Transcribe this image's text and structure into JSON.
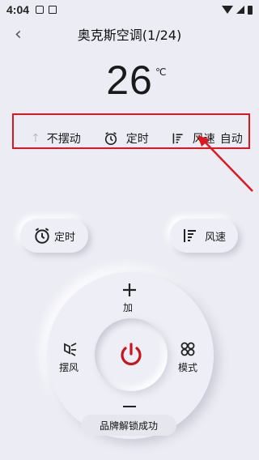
{
  "status_bar": {
    "time": "4:04"
  },
  "header": {
    "back_glyph": "‹",
    "title": "奥克斯空调(1/24)"
  },
  "temperature": {
    "value": "26",
    "unit": "℃"
  },
  "status_row": {
    "swing": "不摆动",
    "timer": "定时",
    "fan_label": "风速",
    "fan_value": "自动"
  },
  "buttons": {
    "timer": "定时",
    "fan": "风速"
  },
  "ring": {
    "plus_label": "加",
    "swing_label": "摆风",
    "mode_label": "模式"
  },
  "toast": "品牌解锁成功",
  "colors": {
    "highlight_box": "#e0161e",
    "power": "#c8161e"
  }
}
